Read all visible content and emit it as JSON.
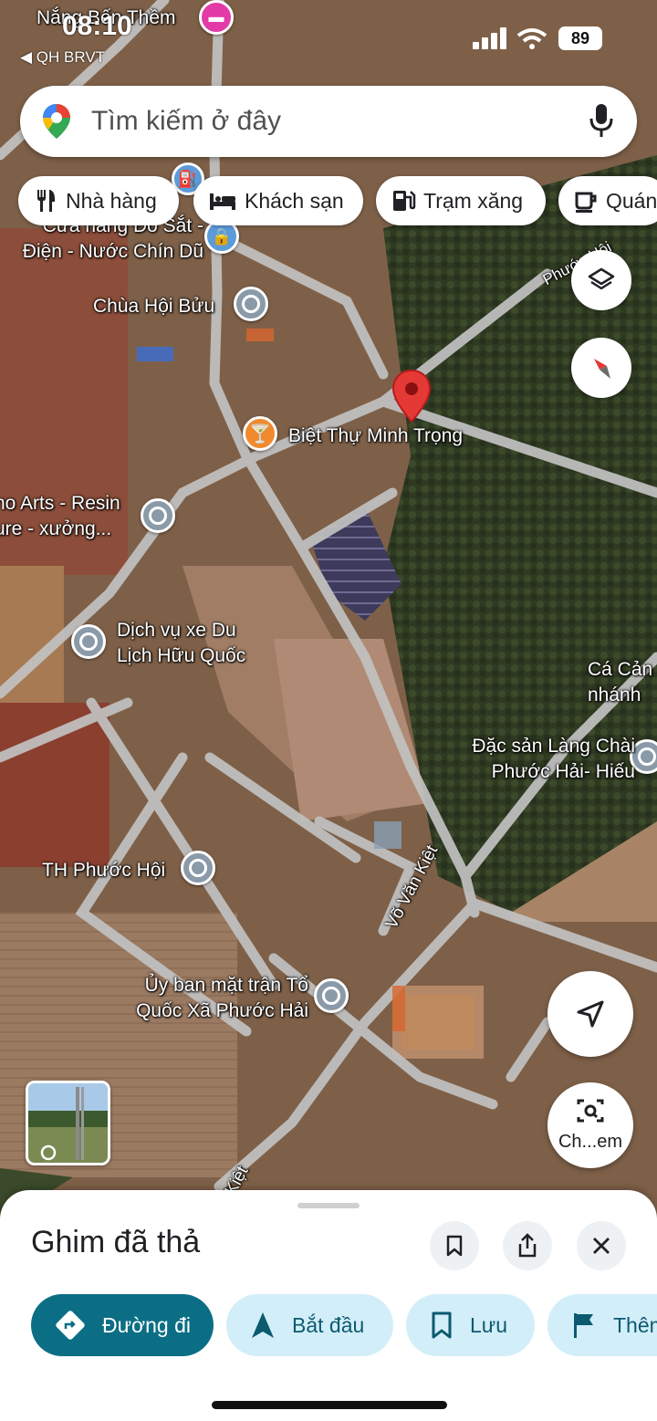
{
  "status_bar": {
    "time": "08:10",
    "back_label": "◀ QH BRVT",
    "battery": "89"
  },
  "search": {
    "placeholder": "Tìm kiếm ở đây",
    "pin_icon": "google-maps-pin-icon",
    "mic_icon": "microphone-icon"
  },
  "chips": [
    {
      "label": "Nhà hàng",
      "icon": "fork-knife-icon"
    },
    {
      "label": "Khách sạn",
      "icon": "bed-icon"
    },
    {
      "label": "Trạm xăng",
      "icon": "fuel-pump-icon"
    },
    {
      "label": "Quán",
      "icon": "coffee-cup-icon"
    }
  ],
  "map": {
    "type": "satellite",
    "dropped_pin_color": "#e53935",
    "labels": {
      "nang_ben_them": "Nắng Bến Thềm",
      "cua_hang": "Cửa hàng Đồ Sắt - Điện - Nước Chín Dũ",
      "chua_hoi_buu": "Chùa Hội Bửu",
      "biet_thu": "Biệt Thự Minh Trọng",
      "arts_resin": "no Arts - Resin ure - xưởng...",
      "dich_vu_xe": "Dịch vụ xe Du Lịch Hữu Quốc",
      "ca_canh": "Cá Cản nhánh",
      "dac_san": "Đặc sản Làng Chài Phước Hải- Hiếu",
      "th_phuoc_hoi": "TH Phước Hội",
      "uy_ban": "Ủy ban mặt trận Tổ Quốc Xã Phước Hải",
      "road_vo_van_kiet": "Võ Văn Kiệt",
      "road_vo_van_kiet_2": "Kiệt",
      "road_phuoc_hoi": "Phước Hội"
    }
  },
  "controls": {
    "layers_icon": "layers-icon",
    "compass_icon": "compass-icon",
    "locate_icon": "navigation-arrow-icon",
    "lens_label": "Ch...em"
  },
  "sheet": {
    "title": "Ghim đã thả",
    "actions": [
      {
        "label": "Đường đi",
        "icon": "directions-icon"
      },
      {
        "label": "Bắt đầu",
        "icon": "navigation-start-icon"
      },
      {
        "label": "Lưu",
        "icon": "bookmark-icon"
      },
      {
        "label": "Thêm",
        "icon": "flag-icon"
      }
    ]
  }
}
